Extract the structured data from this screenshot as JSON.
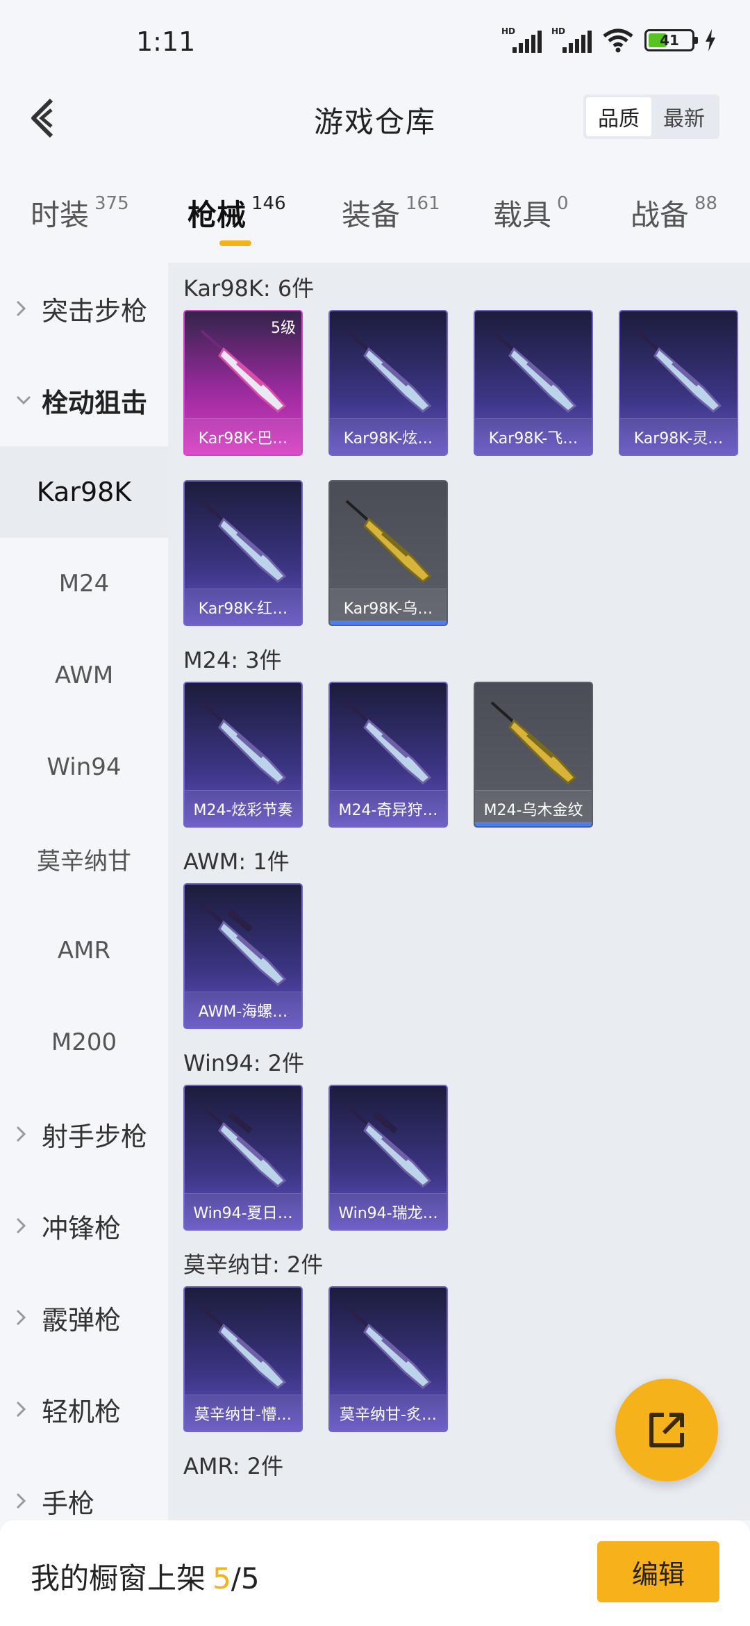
{
  "status_bar": {
    "time": "1:11",
    "signal_label_1": "HD",
    "signal_label_2": "HD",
    "battery": "41"
  },
  "header": {
    "title": "游戏仓库",
    "sort_options": [
      "品质",
      "最新"
    ],
    "sort_selected": "品质"
  },
  "tabs": [
    {
      "label": "时装",
      "count": "375"
    },
    {
      "label": "枪械",
      "count": "146"
    },
    {
      "label": "装备",
      "count": "161"
    },
    {
      "label": "载具",
      "count": "0"
    },
    {
      "label": "战备",
      "count": "88"
    }
  ],
  "active_tab": "枪械",
  "sidebar": {
    "groups": [
      {
        "label": "突击步枪"
      },
      {
        "label": "栓动狙击"
      },
      {
        "label": "射手步枪"
      },
      {
        "label": "冲锋枪"
      },
      {
        "label": "霰弹枪"
      },
      {
        "label": "轻机枪"
      },
      {
        "label": "手枪"
      }
    ],
    "sub_items": [
      "Kar98K",
      "M24",
      "AWM",
      "Win94",
      "莫辛纳甘",
      "AMR",
      "M200"
    ],
    "active_sub": "Kar98K"
  },
  "sections": [
    {
      "title": "Kar98K: 6件",
      "items": [
        {
          "name": "Kar98K-巴…",
          "level": "5级",
          "rarity": "pink",
          "icon": "rifle-icon"
        },
        {
          "name": "Kar98K-炫…",
          "rarity": "purple",
          "icon": "rifle-icon"
        },
        {
          "name": "Kar98K-飞…",
          "rarity": "purple",
          "icon": "rifle-icon"
        },
        {
          "name": "Kar98K-灵…",
          "rarity": "purple",
          "icon": "rifle-icon"
        },
        {
          "name": "Kar98K-红…",
          "rarity": "purple",
          "icon": "rifle-icon"
        },
        {
          "name": "Kar98K-乌…",
          "rarity": "grey",
          "icon": "rifle-icon"
        }
      ]
    },
    {
      "title": "M24: 3件",
      "items": [
        {
          "name": "M24-炫彩节奏",
          "rarity": "purple",
          "icon": "rifle-icon"
        },
        {
          "name": "M24-奇异狩…",
          "rarity": "purple",
          "icon": "rifle-icon"
        },
        {
          "name": "M24-乌木金纹",
          "rarity": "grey",
          "icon": "rifle-icon"
        }
      ]
    },
    {
      "title": "AWM: 1件",
      "items": [
        {
          "name": "AWM-海螺…",
          "rarity": "purple",
          "icon": "sniper-icon"
        }
      ]
    },
    {
      "title": "Win94: 2件",
      "items": [
        {
          "name": "Win94-夏日…",
          "rarity": "purple",
          "icon": "scoped-rifle-icon"
        },
        {
          "name": "Win94-瑞龙…",
          "rarity": "purple",
          "icon": "scoped-rifle-icon"
        }
      ]
    },
    {
      "title": "莫辛纳甘: 2件",
      "items": [
        {
          "name": "莫辛纳甘-懵…",
          "rarity": "purple",
          "icon": "rifle-icon"
        },
        {
          "name": "莫辛纳甘-炙…",
          "rarity": "purple",
          "icon": "rifle-icon"
        }
      ]
    },
    {
      "title": "AMR: 2件",
      "items": []
    }
  ],
  "bottom_bar": {
    "showcase_label": "我的橱窗上架",
    "showcase_current": "5",
    "showcase_sep": "/",
    "showcase_total": "5",
    "edit_label": "编辑"
  },
  "colors": {
    "accent": "#f2b21b",
    "card_purple": "#3b3583",
    "card_pink": "#d73ec3",
    "card_grey": "#5b5e66"
  }
}
